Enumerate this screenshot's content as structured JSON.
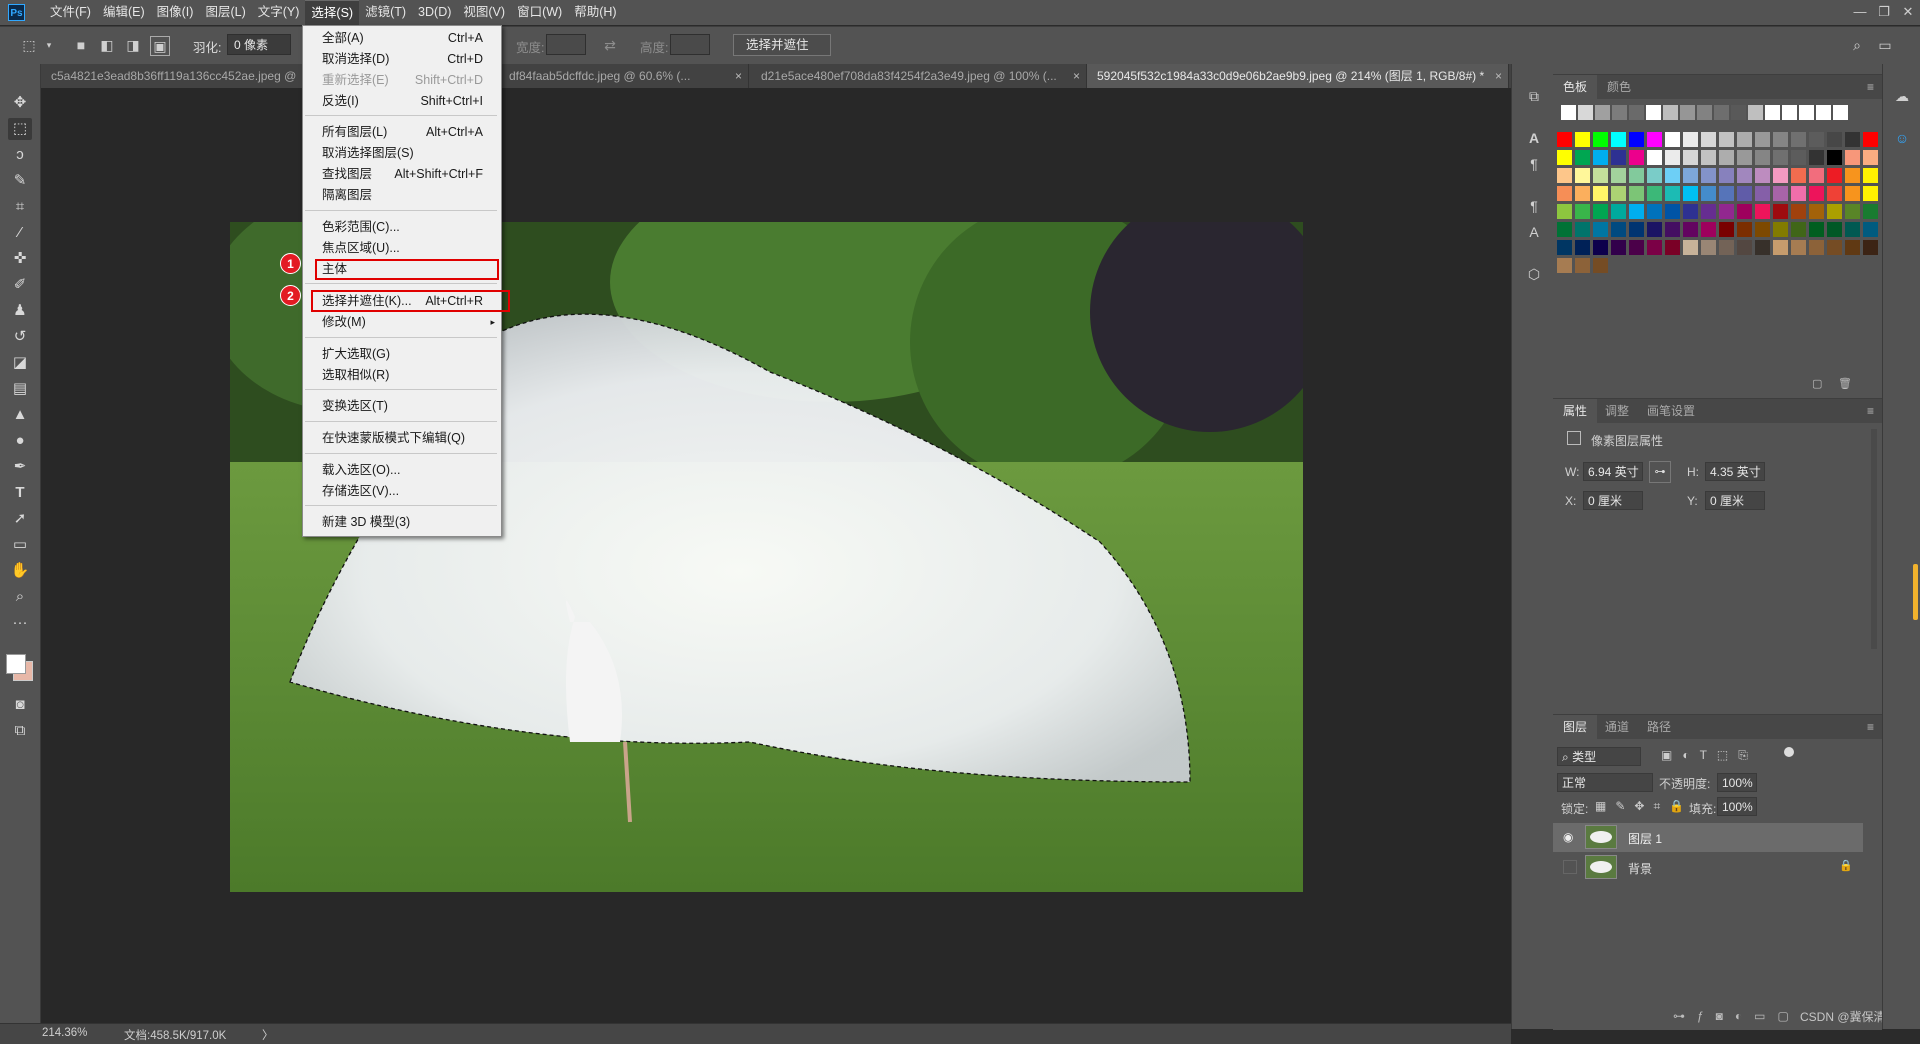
{
  "menubar": {
    "logo": "Ps",
    "items": [
      "文件(F)",
      "编辑(E)",
      "图像(I)",
      "图层(L)",
      "文字(Y)",
      "选择(S)",
      "滤镜(T)",
      "3D(D)",
      "视图(V)",
      "窗口(W)",
      "帮助(H)"
    ],
    "window_controls": [
      "—",
      "❐",
      "✕"
    ]
  },
  "options": {
    "feather_label": "羽化:",
    "feather_value": "0 像素",
    "width_label": "宽度:",
    "height_label": "高度:",
    "select_mask_button": "选择并遮住 ..."
  },
  "tabs": [
    {
      "label": "c5a4821e3ead8b36ff119a136cc452ae.jpeg @"
    },
    {
      "label": "df84faab5dcffdc.jpeg @ 60.6% (...",
      "close": "×"
    },
    {
      "label": "d21e5ace480ef708da83f4254f2a3e49.jpeg @ 100% (...",
      "close": "×"
    },
    {
      "label": "592045f532c1984a33c0d9e06b2ae9b9.jpeg @ 214% (图层 1, RGB/8#) *",
      "close": "×"
    }
  ],
  "select_menu": {
    "items": [
      {
        "label": "全部(A)",
        "shortcut": "Ctrl+A"
      },
      {
        "label": "取消选择(D)",
        "shortcut": "Ctrl+D"
      },
      {
        "label": "重新选择(E)",
        "shortcut": "Shift+Ctrl+D",
        "disabled": true
      },
      {
        "label": "反选(I)",
        "shortcut": "Shift+Ctrl+I"
      },
      {
        "label": "所有图层(L)",
        "shortcut": "Alt+Ctrl+A"
      },
      {
        "label": "取消选择图层(S)",
        "shortcut": ""
      },
      {
        "label": "查找图层",
        "shortcut": "Alt+Shift+Ctrl+F"
      },
      {
        "label": "隔离图层",
        "shortcut": ""
      },
      {
        "label": "色彩范围(C)...",
        "shortcut": ""
      },
      {
        "label": "焦点区域(U)...",
        "shortcut": ""
      },
      {
        "label": "主体",
        "shortcut": ""
      },
      {
        "label": "选择并遮住(K)...",
        "shortcut": "Alt+Ctrl+R"
      },
      {
        "label": "修改(M)",
        "shortcut": "▸"
      },
      {
        "label": "扩大选取(G)",
        "shortcut": ""
      },
      {
        "label": "选取相似(R)",
        "shortcut": ""
      },
      {
        "label": "变换选区(T)",
        "shortcut": ""
      },
      {
        "label": "在快速蒙版模式下编辑(Q)",
        "shortcut": ""
      },
      {
        "label": "载入选区(O)...",
        "shortcut": ""
      },
      {
        "label": "存储选区(V)...",
        "shortcut": ""
      },
      {
        "label": "新建 3D 模型(3)",
        "shortcut": ""
      }
    ],
    "callouts": [
      "1",
      "2"
    ]
  },
  "status": {
    "zoom": "214.36%",
    "doc": "文档:458.5K/917.0K",
    "arrow": "〉"
  },
  "swatches_panel": {
    "tabs": [
      "色板",
      "颜色"
    ]
  },
  "properties_panel": {
    "tabs": [
      "属性",
      "调整",
      "画笔设置"
    ],
    "title": "像素图层属性",
    "w_label": "W:",
    "w_value": "6.94 英寸",
    "h_label": "H:",
    "h_value": "4.35 英寸",
    "x_label": "X:",
    "x_value": "0 厘米",
    "y_label": "Y:",
    "y_value": "0 厘米"
  },
  "layers_panel": {
    "tabs": [
      "图层",
      "通道",
      "路径"
    ],
    "filter_label": "类型",
    "blend_mode": "正常",
    "opacity_label": "不透明度:",
    "opacity_value": "100%",
    "lock_label": "锁定:",
    "fill_label": "填充:",
    "fill_value": "100%",
    "layers": [
      {
        "name": "图层 1",
        "visible": true,
        "selected": true
      },
      {
        "name": "背景",
        "visible": false,
        "locked": true
      }
    ]
  },
  "watermark": "CSDN @冀保清",
  "colors": {
    "swatch_grays": [
      "#ffffff",
      "#d8d8d8",
      "#a0a0a0",
      "#7c7c7c",
      "#6a6a6a",
      "#ffffff",
      "#bdbdbd",
      "#969696",
      "#828282",
      "#6e6e6e",
      "#595959",
      "#bfbfbf",
      "#ffffff",
      "#ffffff",
      "#ffffff",
      "#ffffff",
      "#ffffff"
    ],
    "swatch_rows": [
      [
        "#ff0000",
        "#ffff00",
        "#00ff00",
        "#00ffff",
        "#0000ff",
        "#ff00ff",
        "#ffffff",
        "#ebebeb",
        "#d6d6d6",
        "#c2c2c2",
        "#adadad",
        "#999999",
        "#858585",
        "#707070",
        "#5c5c5c",
        "#474747",
        "#333333",
        "#ff0000"
      ],
      [
        "#ffff00",
        "#00a651",
        "#00aeef",
        "#2e3192",
        "#ec008c",
        "#ffffff",
        "#ebebeb",
        "#d6d6d6",
        "#c2c2c2",
        "#adadad",
        "#999999",
        "#858585",
        "#707070",
        "#5c5c5c",
        "#333333",
        "#000000",
        "#f7977a",
        "#f9ad81"
      ],
      [
        "#fdc68a",
        "#fff79a",
        "#c4df9b",
        "#a3d39c",
        "#82ca9c",
        "#7accc8",
        "#6dcff6",
        "#7da7d9",
        "#8393ca",
        "#8781bd",
        "#a187be",
        "#bd8cbf",
        "#f49ac1",
        "#f26c4f",
        "#f26d7d",
        "#ed1c24",
        "#f7941d",
        "#fff200"
      ],
      [
        "#f68e56",
        "#fbaf5d",
        "#fff568",
        "#acd373",
        "#7cc576",
        "#3cb878",
        "#1cbbb4",
        "#00bff3",
        "#448ccb",
        "#5674b9",
        "#605ca8",
        "#855fa8",
        "#a864a8",
        "#f06eaa",
        "#ed145b",
        "#ef4136",
        "#f7941d",
        "#fff200"
      ],
      [
        "#8dc63f",
        "#39b54a",
        "#00a651",
        "#00a99d",
        "#00aeef",
        "#0072bc",
        "#0054a6",
        "#2e3192",
        "#662d91",
        "#92278f",
        "#9e005d",
        "#ed145b",
        "#9e0b0f",
        "#a0410d",
        "#a36209",
        "#aba000",
        "#598527",
        "#197b30"
      ],
      [
        "#007236",
        "#00746b",
        "#0076a3",
        "#004a80",
        "#003471",
        "#1b1464",
        "#440e62",
        "#630460",
        "#9e005d",
        "#790000",
        "#7b2e00",
        "#7d4900",
        "#827b00",
        "#406618",
        "#005e20",
        "#005826",
        "#005952",
        "#005b7f"
      ],
      [
        "#003663",
        "#002157",
        "#0d004c",
        "#32004b",
        "#4b0049",
        "#7b0046",
        "#7a0026",
        "#c7b299",
        "#998675",
        "#736357",
        "#534741",
        "#37302a",
        "#c69c6d",
        "#a67c52",
        "#8c6239",
        "#754c24",
        "#603913",
        "#3c2415"
      ]
    ]
  }
}
